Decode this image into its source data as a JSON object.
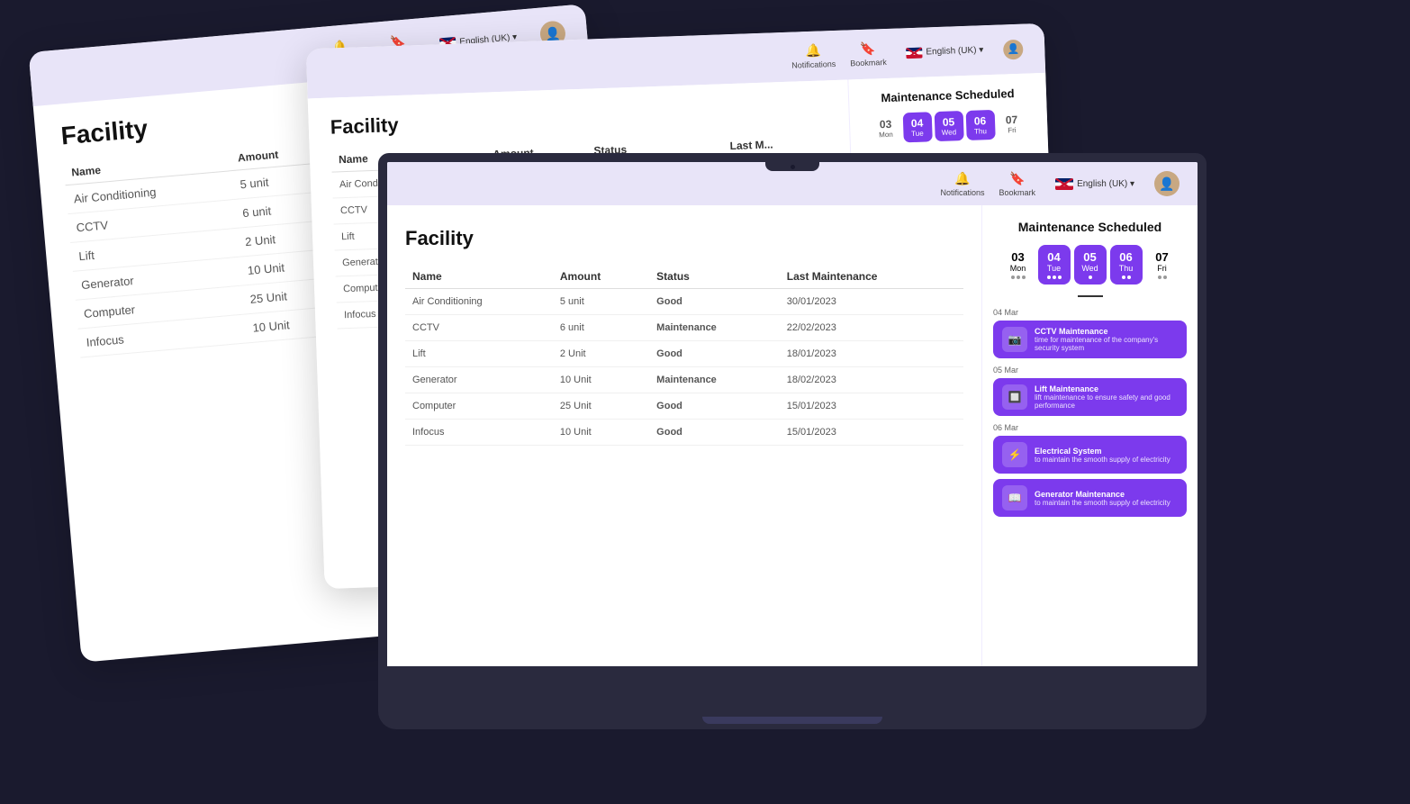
{
  "header": {
    "notifications_label": "Notifications",
    "bookmark_label": "Bookmark",
    "language_label": "English (UK)",
    "language_dropdown": "▾"
  },
  "facility": {
    "title": "Facility",
    "columns": [
      "Name",
      "Amount",
      "Status",
      "Last Maintenance"
    ],
    "rows": [
      {
        "name": "Air Conditioning",
        "amount": "5 unit",
        "status": "Good",
        "status_type": "good",
        "last_maintenance": "30/01/2023"
      },
      {
        "name": "CCTV",
        "amount": "6 unit",
        "status": "Maintenance",
        "status_type": "maintenance",
        "last_maintenance": "22/02/2023"
      },
      {
        "name": "Lift",
        "amount": "2 Unit",
        "status": "Good",
        "status_type": "good",
        "last_maintenance": "18/01/2023"
      },
      {
        "name": "Generator",
        "amount": "10 Unit",
        "status": "Maintenance",
        "status_type": "maintenance",
        "last_maintenance": "18/02/2023"
      },
      {
        "name": "Computer",
        "amount": "25 Unit",
        "status": "Good",
        "status_type": "good",
        "last_maintenance": "15/01/2023"
      },
      {
        "name": "Infocus",
        "amount": "10 Unit",
        "status": "Good",
        "status_type": "good",
        "last_maintenance": "15/01/2023"
      }
    ]
  },
  "maintenance_scheduled": {
    "title": "Maintenance Scheduled",
    "calendar": {
      "days": [
        {
          "num": "03",
          "name": "Mon",
          "active": false,
          "dots": 3,
          "dot_type": "gray"
        },
        {
          "num": "04",
          "name": "Tue",
          "active": true,
          "dots": 3,
          "dot_type": "white"
        },
        {
          "num": "05",
          "name": "Wed",
          "active": true,
          "dots": 1,
          "dot_type": "white"
        },
        {
          "num": "06",
          "name": "Thu",
          "active": true,
          "dots": 2,
          "dot_type": "white"
        },
        {
          "num": "07",
          "name": "Fri",
          "active": false,
          "dots": 2,
          "dot_type": "gray"
        }
      ]
    },
    "events": [
      {
        "date_marker": "04 Mar",
        "items": [
          {
            "title": "CCTV Maintenance",
            "desc": "time for maintenance of the company's security system",
            "icon": "📷"
          }
        ]
      },
      {
        "date_marker": "05 Mar",
        "items": [
          {
            "title": "Lift Maintenance",
            "desc": "lift maintenance to ensure safety and good performance",
            "icon": "🔲"
          }
        ]
      },
      {
        "date_marker": "06 Mar",
        "items": [
          {
            "title": "Electrical System",
            "desc": "to maintain the smooth supply of electricity",
            "icon": "⚡"
          },
          {
            "title": "Generator Maintenance",
            "desc": "to maintain the smooth supply of electricity",
            "icon": "📖"
          }
        ]
      }
    ]
  },
  "bg_calendar_days": [
    {
      "num": "03",
      "name": "",
      "active": false
    },
    {
      "num": "04",
      "name": "",
      "active": true
    },
    {
      "num": "05",
      "name": "",
      "active": true
    },
    {
      "num": "06",
      "name": "",
      "active": true
    },
    {
      "num": "07",
      "name": "",
      "active": false
    }
  ]
}
